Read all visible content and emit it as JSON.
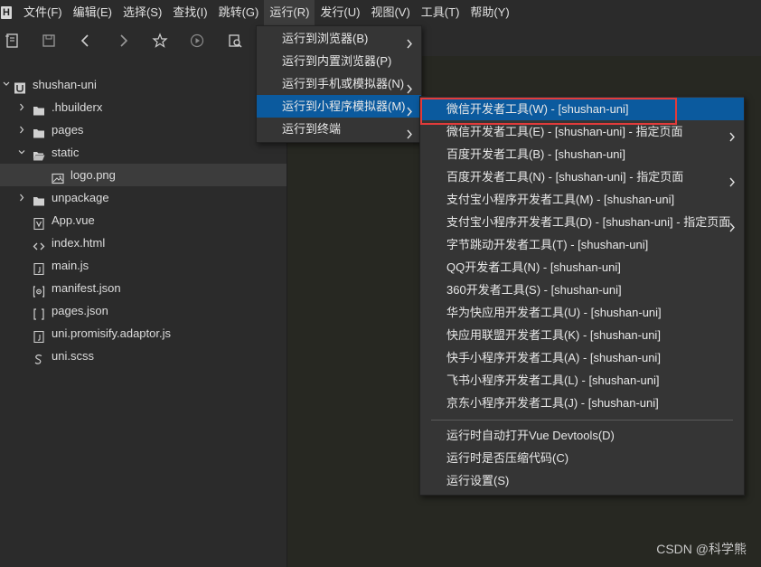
{
  "menubar": {
    "items": [
      "文件(F)",
      "编辑(E)",
      "选择(S)",
      "查找(I)",
      "跳转(G)",
      "运行(R)",
      "发行(U)",
      "视图(V)",
      "工具(T)",
      "帮助(Y)"
    ],
    "active_index": 5
  },
  "toolbar": {
    "icons": [
      "new-file-icon",
      "save-icon",
      "back-icon",
      "forward-icon",
      "star-icon",
      "run-icon",
      "browser-preview-icon"
    ]
  },
  "sidebar": {
    "project": "shushan-uni",
    "items": [
      {
        "label": ".hbuilderx",
        "icon": "folder-icon",
        "expanded": false
      },
      {
        "label": "pages",
        "icon": "folder-icon",
        "expanded": false
      },
      {
        "label": "static",
        "icon": "folder-icon",
        "expanded": true
      },
      {
        "label": "logo.png",
        "icon": "image-file-icon",
        "selected": true
      },
      {
        "label": "unpackage",
        "icon": "folder-icon",
        "expanded": false
      },
      {
        "label": "App.vue",
        "icon": "vue-file-icon"
      },
      {
        "label": "index.html",
        "icon": "html-file-icon"
      },
      {
        "label": "main.js",
        "icon": "js-file-icon"
      },
      {
        "label": "manifest.json",
        "icon": "manifest-file-icon"
      },
      {
        "label": "pages.json",
        "icon": "json-file-icon"
      },
      {
        "label": "uni.promisify.adaptor.js",
        "icon": "js-file-icon"
      },
      {
        "label": "uni.scss",
        "icon": "scss-file-icon"
      }
    ]
  },
  "run_menu": {
    "items": [
      {
        "label": "运行到浏览器(B)",
        "submenu": true
      },
      {
        "label": "运行到内置浏览器(P)",
        "submenu": false
      },
      {
        "label": "运行到手机或模拟器(N)",
        "submenu": true
      },
      {
        "label": "运行到小程序模拟器(M)",
        "submenu": true,
        "highlighted": true
      },
      {
        "label": "运行到终端",
        "submenu": true
      }
    ]
  },
  "miniprogram_menu": {
    "items": [
      {
        "label": "微信开发者工具(W) - [shushan-uni]",
        "submenu": false,
        "highlighted": true
      },
      {
        "label": "微信开发者工具(E) - [shushan-uni] - 指定页面",
        "submenu": true
      },
      {
        "label": "百度开发者工具(B) - [shushan-uni]",
        "submenu": false
      },
      {
        "label": "百度开发者工具(N) - [shushan-uni] - 指定页面",
        "submenu": true
      },
      {
        "label": "支付宝小程序开发者工具(M) - [shushan-uni]",
        "submenu": false
      },
      {
        "label": "支付宝小程序开发者工具(D) - [shushan-uni] - 指定页面",
        "submenu": true
      },
      {
        "label": "字节跳动开发者工具(T) - [shushan-uni]",
        "submenu": false
      },
      {
        "label": "QQ开发者工具(N) - [shushan-uni]",
        "submenu": false
      },
      {
        "label": "360开发者工具(S) - [shushan-uni]",
        "submenu": false
      },
      {
        "label": "华为快应用开发者工具(U) - [shushan-uni]",
        "submenu": false
      },
      {
        "label": "快应用联盟开发者工具(K) - [shushan-uni]",
        "submenu": false
      },
      {
        "label": "快手小程序开发者工具(A) - [shushan-uni]",
        "submenu": false
      },
      {
        "label": "飞书小程序开发者工具(L) - [shushan-uni]",
        "submenu": false
      },
      {
        "label": "京东小程序开发者工具(J) - [shushan-uni]",
        "submenu": false
      }
    ],
    "extra_items": [
      {
        "label": "运行时自动打开Vue Devtools(D)"
      },
      {
        "label": "运行时是否压缩代码(C)"
      },
      {
        "label": "运行设置(S)"
      }
    ]
  },
  "watermark": "CSDN @科学熊",
  "colors": {
    "background": "#272822",
    "panel": "#2b2b2b",
    "menu": "#353535",
    "highlight": "#0b5a9e",
    "annotation_box": "#e23b3b"
  }
}
